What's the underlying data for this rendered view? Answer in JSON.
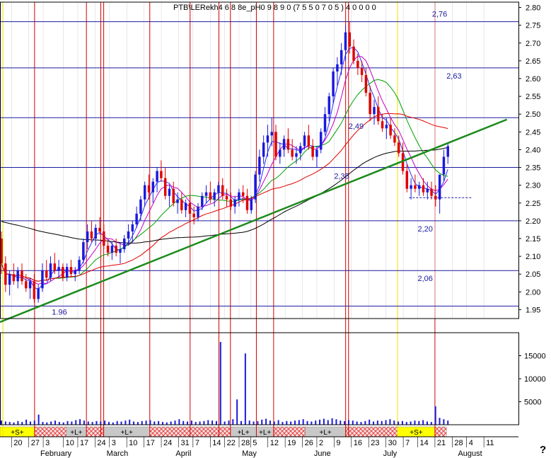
{
  "title": "PTB\\LERekh4 6 8 8e_pH0 9 8 9 0 (7 5 5 0 7 0 5 ) 4 0 0 0 0",
  "question_mark": "?",
  "colors": {
    "price_grid": "#1a1aa0",
    "red_vline": "#d40000",
    "yellow_vline": "#f0e000",
    "trendline": "#1b8a1b",
    "bull": "#1a1adc",
    "bear": "#e00000",
    "ma_fast": "#2b2bff",
    "ma_mid": "#c000c0",
    "ma_green": "#00a000",
    "ma_red": "#e00000",
    "ma_black": "#000000",
    "volume": "#1a1adc",
    "label_blue": "#1a1aa0"
  },
  "chart_data": {
    "type": "candlestick",
    "price_axis": {
      "ticks": [
        "2.80",
        "2.75",
        "2.70",
        "2.65",
        "2.60",
        "2.55",
        "2.50",
        "2.45",
        "2.40",
        "2.35",
        "2.30",
        "2.25",
        "2.20",
        "2.15",
        "2.10",
        "2.05",
        "2.00",
        "1.95"
      ],
      "ylim": [
        1.925,
        2.815
      ]
    },
    "volume_axis": {
      "ticks": [
        "15000",
        "10000",
        "5000"
      ],
      "ylim": [
        0,
        20000
      ]
    },
    "horizontal_levels": [
      {
        "value": 2.76,
        "label": "2,76",
        "label_x_day": 150
      },
      {
        "value": 2.63,
        "label": "2,63",
        "label_x_day": 155
      },
      {
        "value": 2.49,
        "label": "2,49",
        "label_x_day": 121
      },
      {
        "value": 2.35,
        "label": "2,35",
        "label_x_day": 116
      },
      {
        "value": 2.2,
        "label": "2,20",
        "label_x_day": 145
      },
      {
        "value": 2.06,
        "label": "2,06",
        "label_x_day": 145
      }
    ],
    "trendline_label": {
      "value": 1.96,
      "label": "1.96",
      "x_day": 18
    },
    "trendline": {
      "x1_day": 0,
      "y1": 1.915,
      "x2_day": 176,
      "y2": 2.485
    },
    "dashed_level": {
      "value": 2.265,
      "from_day": 142,
      "to_day": 164
    },
    "x_ticks": [
      {
        "label": "20",
        "day": 4
      },
      {
        "label": "27",
        "day": 10
      },
      {
        "label": "3",
        "day": 15
      },
      {
        "label": "10",
        "day": 22
      },
      {
        "label": "17",
        "day": 27
      },
      {
        "label": "24",
        "day": 33
      },
      {
        "label": "3",
        "day": 38
      },
      {
        "label": "10",
        "day": 44
      },
      {
        "label": "17",
        "day": 50
      },
      {
        "label": "24",
        "day": 56
      },
      {
        "label": "31",
        "day": 62
      },
      {
        "label": "7",
        "day": 67
      },
      {
        "label": "14",
        "day": 73
      },
      {
        "label": "22",
        "day": 78
      },
      {
        "label": "28",
        "day": 83
      },
      {
        "label": "5",
        "day": 87
      },
      {
        "label": "12",
        "day": 93
      },
      {
        "label": "19",
        "day": 99
      },
      {
        "label": "26",
        "day": 105
      },
      {
        "label": "2",
        "day": 110
      },
      {
        "label": "9",
        "day": 116
      },
      {
        "label": "16",
        "day": 122
      },
      {
        "label": "23",
        "day": 128
      },
      {
        "label": "30",
        "day": 134
      },
      {
        "label": "7",
        "day": 140
      },
      {
        "label": "14",
        "day": 145
      },
      {
        "label": "21",
        "day": 151
      },
      {
        "label": "28",
        "day": 157
      },
      {
        "label": "4",
        "day": 162
      },
      {
        "label": "11",
        "day": 168
      }
    ],
    "month_labels": [
      {
        "label": "February",
        "day": 14
      },
      {
        "label": "March",
        "day": 37
      },
      {
        "label": "April",
        "day": 61
      },
      {
        "label": "May",
        "day": 84
      },
      {
        "label": "June",
        "day": 109
      },
      {
        "label": "July",
        "day": 133
      },
      {
        "label": "August",
        "day": 159
      }
    ],
    "signal_bands": [
      {
        "label": "+S+",
        "from_day": 0,
        "to_day": 12,
        "style": "yellow"
      },
      {
        "label": "",
        "from_day": 12,
        "to_day": 23,
        "style": "hatch"
      },
      {
        "label": "+L+",
        "from_day": 23,
        "to_day": 30,
        "style": "gray"
      },
      {
        "label": "",
        "from_day": 30,
        "to_day": 36,
        "style": "hatch"
      },
      {
        "label": "+L+",
        "from_day": 36,
        "to_day": 52,
        "style": "gray"
      },
      {
        "label": "",
        "from_day": 52,
        "to_day": 80,
        "style": "hatch"
      },
      {
        "label": "+L+",
        "from_day": 80,
        "to_day": 89,
        "style": "gray"
      },
      {
        "label": "+L+",
        "from_day": 89,
        "to_day": 95,
        "style": "gray"
      },
      {
        "label": "",
        "from_day": 95,
        "to_day": 106,
        "style": "hatch"
      },
      {
        "label": "+L+",
        "from_day": 106,
        "to_day": 120,
        "style": "gray"
      },
      {
        "label": "",
        "from_day": 120,
        "to_day": 138,
        "style": "hatch"
      },
      {
        "label": "+S+",
        "from_day": 138,
        "to_day": 151,
        "style": "yellow"
      },
      {
        "label": "",
        "from_day": 151,
        "to_day": 155,
        "style": "hatch"
      }
    ],
    "red_vlines_day": [
      12,
      30,
      35,
      36,
      52,
      66,
      76,
      80,
      89,
      95,
      120,
      121,
      151
    ],
    "yellow_vlines_day": [
      1,
      138
    ],
    "candles": [
      [
        2.15,
        2.17,
        2.05,
        2.08
      ],
      [
        2.08,
        2.1,
        2.0,
        2.02
      ],
      [
        2.02,
        2.06,
        1.99,
        2.05
      ],
      [
        2.05,
        2.08,
        2.02,
        2.03
      ],
      [
        2.03,
        2.07,
        2.01,
        2.06
      ],
      [
        2.06,
        2.08,
        2.02,
        2.03
      ],
      [
        2.03,
        2.05,
        2.0,
        2.01
      ],
      [
        2.01,
        2.04,
        1.98,
        2.03
      ],
      [
        2.03,
        2.05,
        1.97,
        1.98
      ],
      [
        1.98,
        2.02,
        1.97,
        2.01
      ],
      [
        2.01,
        2.08,
        2.0,
        2.06
      ],
      [
        2.06,
        2.09,
        2.03,
        2.04
      ],
      [
        2.04,
        2.1,
        2.03,
        2.08
      ],
      [
        2.08,
        2.11,
        2.05,
        2.06
      ],
      [
        2.06,
        2.09,
        2.04,
        2.07
      ],
      [
        2.07,
        2.08,
        2.03,
        2.04
      ],
      [
        2.04,
        2.08,
        2.03,
        2.07
      ],
      [
        2.07,
        2.09,
        2.04,
        2.05
      ],
      [
        2.05,
        2.07,
        2.03,
        2.06
      ],
      [
        2.06,
        2.1,
        2.05,
        2.09
      ],
      [
        2.09,
        2.15,
        2.08,
        2.14
      ],
      [
        2.14,
        2.19,
        2.12,
        2.17
      ],
      [
        2.17,
        2.2,
        2.14,
        2.15
      ],
      [
        2.15,
        2.19,
        2.13,
        2.18
      ],
      [
        2.18,
        2.21,
        2.16,
        2.17
      ],
      [
        2.17,
        2.19,
        2.12,
        2.13
      ],
      [
        2.13,
        2.15,
        2.1,
        2.11
      ],
      [
        2.11,
        2.14,
        2.09,
        2.13
      ],
      [
        2.13,
        2.15,
        2.1,
        2.11
      ],
      [
        2.11,
        2.14,
        2.08,
        2.12
      ],
      [
        2.12,
        2.16,
        2.11,
        2.15
      ],
      [
        2.15,
        2.19,
        2.13,
        2.17
      ],
      [
        2.17,
        2.2,
        2.14,
        2.19
      ],
      [
        2.19,
        2.24,
        2.18,
        2.22
      ],
      [
        2.22,
        2.27,
        2.2,
        2.26
      ],
      [
        2.26,
        2.31,
        2.24,
        2.3
      ],
      [
        2.3,
        2.33,
        2.26,
        2.28
      ],
      [
        2.28,
        2.32,
        2.25,
        2.31
      ],
      [
        2.31,
        2.35,
        2.28,
        2.34
      ],
      [
        2.34,
        2.37,
        2.31,
        2.32
      ],
      [
        2.32,
        2.35,
        2.26,
        2.27
      ],
      [
        2.27,
        2.3,
        2.24,
        2.29
      ],
      [
        2.29,
        2.31,
        2.24,
        2.25
      ],
      [
        2.25,
        2.28,
        2.22,
        2.26
      ],
      [
        2.26,
        2.28,
        2.22,
        2.23
      ],
      [
        2.23,
        2.26,
        2.21,
        2.25
      ],
      [
        2.25,
        2.27,
        2.2,
        2.22
      ],
      [
        2.22,
        2.24,
        2.19,
        2.21
      ],
      [
        2.21,
        2.25,
        2.2,
        2.24
      ],
      [
        2.24,
        2.28,
        2.23,
        2.27
      ],
      [
        2.27,
        2.3,
        2.25,
        2.28
      ],
      [
        2.28,
        2.31,
        2.25,
        2.26
      ],
      [
        2.26,
        2.29,
        2.24,
        2.28
      ],
      [
        2.28,
        2.31,
        2.26,
        2.3
      ],
      [
        2.3,
        2.32,
        2.26,
        2.27
      ],
      [
        2.27,
        2.29,
        2.24,
        2.26
      ],
      [
        2.26,
        2.28,
        2.23,
        2.24
      ],
      [
        2.24,
        2.27,
        2.22,
        2.26
      ],
      [
        2.26,
        2.29,
        2.24,
        2.28
      ],
      [
        2.28,
        2.3,
        2.25,
        2.27
      ],
      [
        2.27,
        2.29,
        2.22,
        2.23
      ],
      [
        2.23,
        2.27,
        2.22,
        2.26
      ],
      [
        2.26,
        2.34,
        2.25,
        2.33
      ],
      [
        2.33,
        2.4,
        2.31,
        2.38
      ],
      [
        2.38,
        2.44,
        2.36,
        2.42
      ],
      [
        2.42,
        2.47,
        2.38,
        2.44
      ],
      [
        2.44,
        2.49,
        2.41,
        2.45
      ],
      [
        2.45,
        2.47,
        2.37,
        2.38
      ],
      [
        2.38,
        2.42,
        2.36,
        2.4
      ],
      [
        2.4,
        2.44,
        2.38,
        2.43
      ],
      [
        2.43,
        2.46,
        2.39,
        2.4
      ],
      [
        2.4,
        2.43,
        2.37,
        2.38
      ],
      [
        2.38,
        2.41,
        2.36,
        2.39
      ],
      [
        2.39,
        2.42,
        2.37,
        2.41
      ],
      [
        2.41,
        2.45,
        2.4,
        2.44
      ],
      [
        2.44,
        2.47,
        2.4,
        2.41
      ],
      [
        2.41,
        2.43,
        2.37,
        2.38
      ],
      [
        2.38,
        2.41,
        2.35,
        2.4
      ],
      [
        2.4,
        2.46,
        2.39,
        2.45
      ],
      [
        2.45,
        2.52,
        2.44,
        2.5
      ],
      [
        2.5,
        2.56,
        2.48,
        2.55
      ],
      [
        2.55,
        2.63,
        2.53,
        2.62
      ],
      [
        2.62,
        2.66,
        2.58,
        2.64
      ],
      [
        2.64,
        2.7,
        2.61,
        2.68
      ],
      [
        2.68,
        2.75,
        2.65,
        2.73
      ],
      [
        2.73,
        2.76,
        2.67,
        2.69
      ],
      [
        2.69,
        2.71,
        2.64,
        2.65
      ],
      [
        2.65,
        2.67,
        2.61,
        2.63
      ],
      [
        2.63,
        2.65,
        2.59,
        2.61
      ],
      [
        2.61,
        2.63,
        2.55,
        2.56
      ],
      [
        2.56,
        2.58,
        2.48,
        2.5
      ],
      [
        2.5,
        2.54,
        2.47,
        2.52
      ],
      [
        2.52,
        2.55,
        2.47,
        2.48
      ],
      [
        2.48,
        2.5,
        2.45,
        2.46
      ],
      [
        2.46,
        2.49,
        2.43,
        2.47
      ],
      [
        2.47,
        2.49,
        2.43,
        2.44
      ],
      [
        2.44,
        2.46,
        2.41,
        2.42
      ],
      [
        2.42,
        2.44,
        2.38,
        2.39
      ],
      [
        2.39,
        2.42,
        2.33,
        2.34
      ],
      [
        2.34,
        2.36,
        2.28,
        2.29
      ],
      [
        2.29,
        2.32,
        2.26,
        2.3
      ],
      [
        2.3,
        2.33,
        2.28,
        2.29
      ],
      [
        2.29,
        2.31,
        2.27,
        2.3
      ],
      [
        2.3,
        2.32,
        2.27,
        2.28
      ],
      [
        2.28,
        2.31,
        2.26,
        2.29
      ],
      [
        2.29,
        2.31,
        2.26,
        2.27
      ],
      [
        2.27,
        2.3,
        2.24,
        2.26
      ],
      [
        2.26,
        2.28,
        2.22,
        2.33
      ],
      [
        2.33,
        2.4,
        2.31,
        2.38
      ],
      [
        2.38,
        2.42,
        2.36,
        2.41
      ]
    ],
    "volumes": [
      900,
      700,
      600,
      500,
      800,
      600,
      1100,
      700,
      900,
      2200,
      600,
      500,
      700,
      900,
      600,
      500,
      800,
      700,
      1000,
      1200,
      900,
      700,
      600,
      800,
      700,
      900,
      600,
      500,
      800,
      700,
      900,
      1100,
      700,
      600,
      800,
      900,
      1000,
      700,
      800,
      600,
      500,
      700,
      900,
      1200,
      800,
      700,
      900,
      600,
      700,
      800,
      1000,
      900,
      800,
      18000,
      700,
      900,
      1200,
      5500,
      800,
      15500,
      900,
      700,
      800,
      1100,
      1300,
      900,
      700,
      1000,
      600,
      800,
      700,
      900,
      1000,
      1200,
      800,
      700,
      900,
      1100,
      1300,
      1000,
      1400,
      1200,
      900,
      800,
      1000,
      900,
      700,
      600,
      800,
      1100,
      700,
      900,
      800,
      1000,
      1200,
      900,
      700,
      800,
      600,
      700,
      900,
      800,
      1000,
      700,
      600,
      4000,
      1500,
      1200,
      900
    ],
    "moving_averages": [
      {
        "key": "ma_fast",
        "period": 4
      },
      {
        "key": "ma_mid",
        "period": 7
      },
      {
        "key": "ma_green",
        "period": 14
      },
      {
        "key": "ma_red",
        "period": 30
      },
      {
        "key": "ma_black",
        "period": 60,
        "seed": 2.2
      }
    ]
  }
}
